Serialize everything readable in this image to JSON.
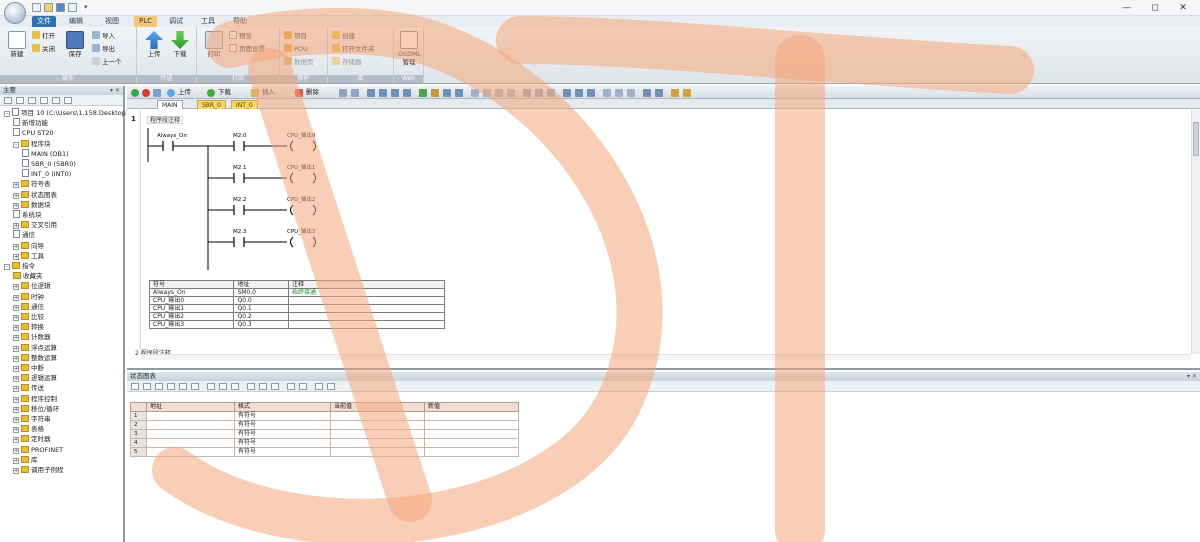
{
  "title_bar": {
    "quick_access_more": "▾",
    "minimize": "—",
    "maximize": "◻",
    "close": "✕"
  },
  "ribbon_tabs": [
    "文件",
    "编辑",
    "视图",
    "PLC",
    "调试",
    "工具",
    "帮助"
  ],
  "ribbon": {
    "groups": [
      {
        "caption": "操作"
      },
      {
        "caption": "传送"
      },
      {
        "caption": "打印"
      },
      {
        "caption": "保护"
      },
      {
        "caption": "库"
      },
      {
        "caption": "Web"
      }
    ],
    "new_label": "新建",
    "open_label": "打开",
    "close_label": "关闭",
    "save_label": "保存",
    "import_label": "导入",
    "export_label": "导出",
    "previous_label": "上一个",
    "upload_label": "上传",
    "download_label": "下载",
    "print_label": "打印",
    "preview_label": "预览",
    "page_setup_label": "页面设置",
    "project_label": "项目",
    "pou_label": "POU",
    "data_page_label": "数据页",
    "create_label": "创建",
    "open_folder_label": "打开文件夹",
    "memory_label": "存储器",
    "gsdml_label": "GSDML管理"
  },
  "nav_pane": {
    "title": "主要",
    "pin": "▾ ✕",
    "tree": [
      {
        "level": 0,
        "exp": "-",
        "icon": "doc",
        "label": "项目 10 (C:\\Users\\1.158.Desktop)"
      },
      {
        "level": 1,
        "exp": "",
        "icon": "doc",
        "label": "新增功能"
      },
      {
        "level": 1,
        "exp": "",
        "icon": "doc",
        "label": "CPU ST20"
      },
      {
        "level": 1,
        "exp": "-",
        "icon": "folder",
        "label": "程序块"
      },
      {
        "level": 2,
        "exp": "",
        "icon": "doc",
        "label": "MAIN (OB1)"
      },
      {
        "level": 2,
        "exp": "",
        "icon": "doc",
        "label": "SBR_0 (SBR0)"
      },
      {
        "level": 2,
        "exp": "",
        "icon": "doc",
        "label": "INT_0 (INT0)"
      },
      {
        "level": 1,
        "exp": "+",
        "icon": "folder",
        "label": "符号表"
      },
      {
        "level": 1,
        "exp": "+",
        "icon": "folder",
        "label": "状态图表"
      },
      {
        "level": 1,
        "exp": "+",
        "icon": "folder",
        "label": "数据块"
      },
      {
        "level": 1,
        "exp": "",
        "icon": "doc",
        "label": "系统块"
      },
      {
        "level": 1,
        "exp": "+",
        "icon": "folder",
        "label": "交叉引用"
      },
      {
        "level": 1,
        "exp": "",
        "icon": "doc",
        "label": "通信"
      },
      {
        "level": 1,
        "exp": "+",
        "icon": "folder",
        "label": "向导"
      },
      {
        "level": 1,
        "exp": "+",
        "icon": "folder",
        "label": "工具"
      },
      {
        "level": 0,
        "exp": "-",
        "icon": "folder",
        "label": "指令"
      },
      {
        "level": 1,
        "exp": "",
        "icon": "folder",
        "label": "收藏夹"
      },
      {
        "level": 1,
        "exp": "+",
        "icon": "folder",
        "label": "位逻辑"
      },
      {
        "level": 1,
        "exp": "+",
        "icon": "folder",
        "label": "时钟"
      },
      {
        "level": 1,
        "exp": "+",
        "icon": "folder",
        "label": "通信"
      },
      {
        "level": 1,
        "exp": "+",
        "icon": "folder",
        "label": "比较"
      },
      {
        "level": 1,
        "exp": "+",
        "icon": "folder",
        "label": "转换"
      },
      {
        "level": 1,
        "exp": "+",
        "icon": "folder",
        "label": "计数器"
      },
      {
        "level": 1,
        "exp": "+",
        "icon": "folder",
        "label": "浮点运算"
      },
      {
        "level": 1,
        "exp": "+",
        "icon": "folder",
        "label": "整数运算"
      },
      {
        "level": 1,
        "exp": "+",
        "icon": "folder",
        "label": "中断"
      },
      {
        "level": 1,
        "exp": "+",
        "icon": "folder",
        "label": "逻辑运算"
      },
      {
        "level": 1,
        "exp": "+",
        "icon": "folder",
        "label": "传送"
      },
      {
        "level": 1,
        "exp": "+",
        "icon": "folder",
        "label": "程序控制"
      },
      {
        "level": 1,
        "exp": "+",
        "icon": "folder",
        "label": "移位/循环"
      },
      {
        "level": 1,
        "exp": "+",
        "icon": "folder",
        "label": "字符串"
      },
      {
        "level": 1,
        "exp": "+",
        "icon": "folder",
        "label": "表格"
      },
      {
        "level": 1,
        "exp": "+",
        "icon": "folder",
        "label": "定时器"
      },
      {
        "level": 1,
        "exp": "+",
        "icon": "folder",
        "label": "PROFINET"
      },
      {
        "level": 1,
        "exp": "+",
        "icon": "folder",
        "label": "库"
      },
      {
        "level": 1,
        "exp": "+",
        "icon": "folder",
        "label": "调用子例程"
      }
    ]
  },
  "editor": {
    "toolbar": {
      "upload": "上传",
      "download": "下载",
      "insert": "插入",
      "delete": "删除"
    },
    "doc_tabs": [
      "MAIN",
      "SBR_0",
      "INT_0"
    ],
    "network1_num": "1",
    "network1_comment": "程序段注释",
    "network2_label": "2  程序段注释",
    "ladder": {
      "first_contact": "Always_On",
      "rungs": [
        {
          "contact": "M2.0",
          "coil": "CPU_输出0"
        },
        {
          "contact": "M2.1",
          "coil": "CPU_输出1"
        },
        {
          "contact": "M2.2",
          "coil": "CPU_输出2"
        },
        {
          "contact": "M2.3",
          "coil": "CPU_输出3"
        }
      ]
    },
    "symbol_table": {
      "headers": [
        "符号",
        "地址",
        "注释"
      ],
      "rows": [
        [
          "Always_On",
          "SM0.0",
          "始终接通"
        ],
        [
          "CPU_输出0",
          "Q0.0",
          ""
        ],
        [
          "CPU_输出1",
          "Q0.1",
          ""
        ],
        [
          "CPU_输出2",
          "Q0.2",
          ""
        ],
        [
          "CPU_输出3",
          "Q0.3",
          ""
        ]
      ]
    }
  },
  "status_chart": {
    "title": "状态图表",
    "pin": "▾ ✕",
    "headers": [
      "地址",
      "格式",
      "当前值",
      "新值"
    ],
    "rows": [
      {
        "n": "1",
        "fmt": "有符号"
      },
      {
        "n": "2",
        "fmt": "有符号"
      },
      {
        "n": "3",
        "fmt": "有符号"
      },
      {
        "n": "4",
        "fmt": "有符号"
      },
      {
        "n": "5",
        "fmt": "有符号"
      }
    ]
  },
  "colors": {
    "active_tab": "#2f6fb2",
    "doc_tab": "#f7d66a",
    "watermark": "#f4a67a"
  }
}
